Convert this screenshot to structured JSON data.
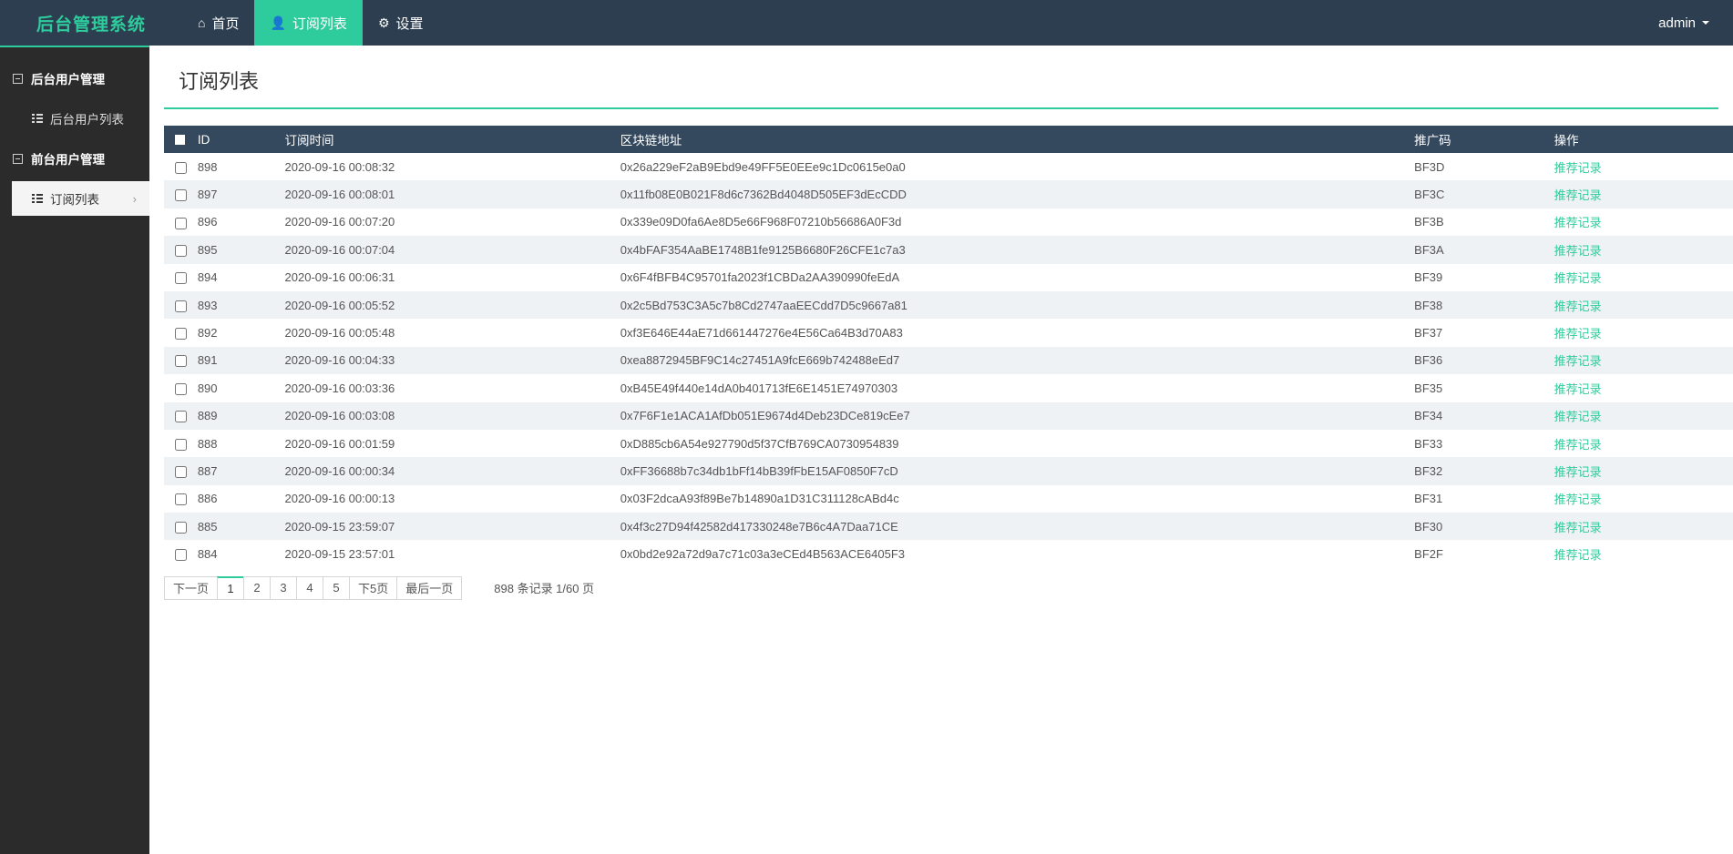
{
  "header": {
    "brand": "后台管理系统",
    "nav": [
      {
        "label": "首页",
        "icon": "home-icon",
        "glyph": "⌂",
        "active": false
      },
      {
        "label": "订阅列表",
        "icon": "user-icon",
        "glyph": "👤",
        "active": true
      },
      {
        "label": "设置",
        "icon": "gear-icon",
        "glyph": "⚙",
        "active": false
      }
    ],
    "user": "admin"
  },
  "sidebar": {
    "groups": [
      {
        "label": "后台用户管理",
        "children": [
          {
            "label": "后台用户列表",
            "active": false
          }
        ]
      },
      {
        "label": "前台用户管理",
        "children": [
          {
            "label": "订阅列表",
            "active": true,
            "chevron": "›"
          }
        ]
      }
    ]
  },
  "main": {
    "title": "订阅列表",
    "table": {
      "columns": [
        "",
        "ID",
        "订阅时间",
        "区块链地址",
        "推广码",
        "操作"
      ],
      "action_label": "推荐记录",
      "rows": [
        {
          "id": "898",
          "time": "2020-09-16 00:08:32",
          "addr": "0x26a229eF2aB9Ebd9e49FF5E0EEe9c1Dc0615e0a0",
          "code": "BF3D"
        },
        {
          "id": "897",
          "time": "2020-09-16 00:08:01",
          "addr": "0x11fb08E0B021F8d6c7362Bd4048D505EF3dEcCDD",
          "code": "BF3C"
        },
        {
          "id": "896",
          "time": "2020-09-16 00:07:20",
          "addr": "0x339e09D0fa6Ae8D5e66F968F07210b56686A0F3d",
          "code": "BF3B"
        },
        {
          "id": "895",
          "time": "2020-09-16 00:07:04",
          "addr": "0x4bFAF354AaBE1748B1fe9125B6680F26CFE1c7a3",
          "code": "BF3A"
        },
        {
          "id": "894",
          "time": "2020-09-16 00:06:31",
          "addr": "0x6F4fBFB4C95701fa2023f1CBDa2AA390990feEdA",
          "code": "BF39"
        },
        {
          "id": "893",
          "time": "2020-09-16 00:05:52",
          "addr": "0x2c5Bd753C3A5c7b8Cd2747aaEECdd7D5c9667a81",
          "code": "BF38"
        },
        {
          "id": "892",
          "time": "2020-09-16 00:05:48",
          "addr": "0xf3E646E44aE71d661447276e4E56Ca64B3d70A83",
          "code": "BF37"
        },
        {
          "id": "891",
          "time": "2020-09-16 00:04:33",
          "addr": "0xea8872945BF9C14c27451A9fcE669b742488eEd7",
          "code": "BF36"
        },
        {
          "id": "890",
          "time": "2020-09-16 00:03:36",
          "addr": "0xB45E49f440e14dA0b401713fE6E1451E74970303",
          "code": "BF35"
        },
        {
          "id": "889",
          "time": "2020-09-16 00:03:08",
          "addr": "0x7F6F1e1ACA1AfDb051E9674d4Deb23DCe819cEe7",
          "code": "BF34"
        },
        {
          "id": "888",
          "time": "2020-09-16 00:01:59",
          "addr": "0xD885cb6A54e927790d5f37CfB769CA0730954839",
          "code": "BF33"
        },
        {
          "id": "887",
          "time": "2020-09-16 00:00:34",
          "addr": "0xFF36688b7c34db1bFf14bB39fFbE15AF0850F7cD",
          "code": "BF32"
        },
        {
          "id": "886",
          "time": "2020-09-16 00:00:13",
          "addr": "0x03F2dcaA93f89Be7b14890a1D31C311128cABd4c",
          "code": "BF31"
        },
        {
          "id": "885",
          "time": "2020-09-15 23:59:07",
          "addr": "0x4f3c27D94f42582d417330248e7B6c4A7Daa71CE",
          "code": "BF30"
        },
        {
          "id": "884",
          "time": "2020-09-15 23:57:01",
          "addr": "0x0bd2e92a72d9a7c71c03a3eCEd4B563ACE6405F3",
          "code": "BF2F"
        }
      ]
    },
    "pagination": {
      "prev": "下一页",
      "pages": [
        "1",
        "2",
        "3",
        "4",
        "5"
      ],
      "active_page": "1",
      "next5": "下5页",
      "last": "最后一页",
      "info": "898 条记录 1/60 页"
    }
  },
  "colors": {
    "accent": "#2ecc9c",
    "navbar": "#2c3e50",
    "sidebar": "#2b2b2b",
    "table_header": "#34495e",
    "row_alt": "#eef2f5"
  }
}
